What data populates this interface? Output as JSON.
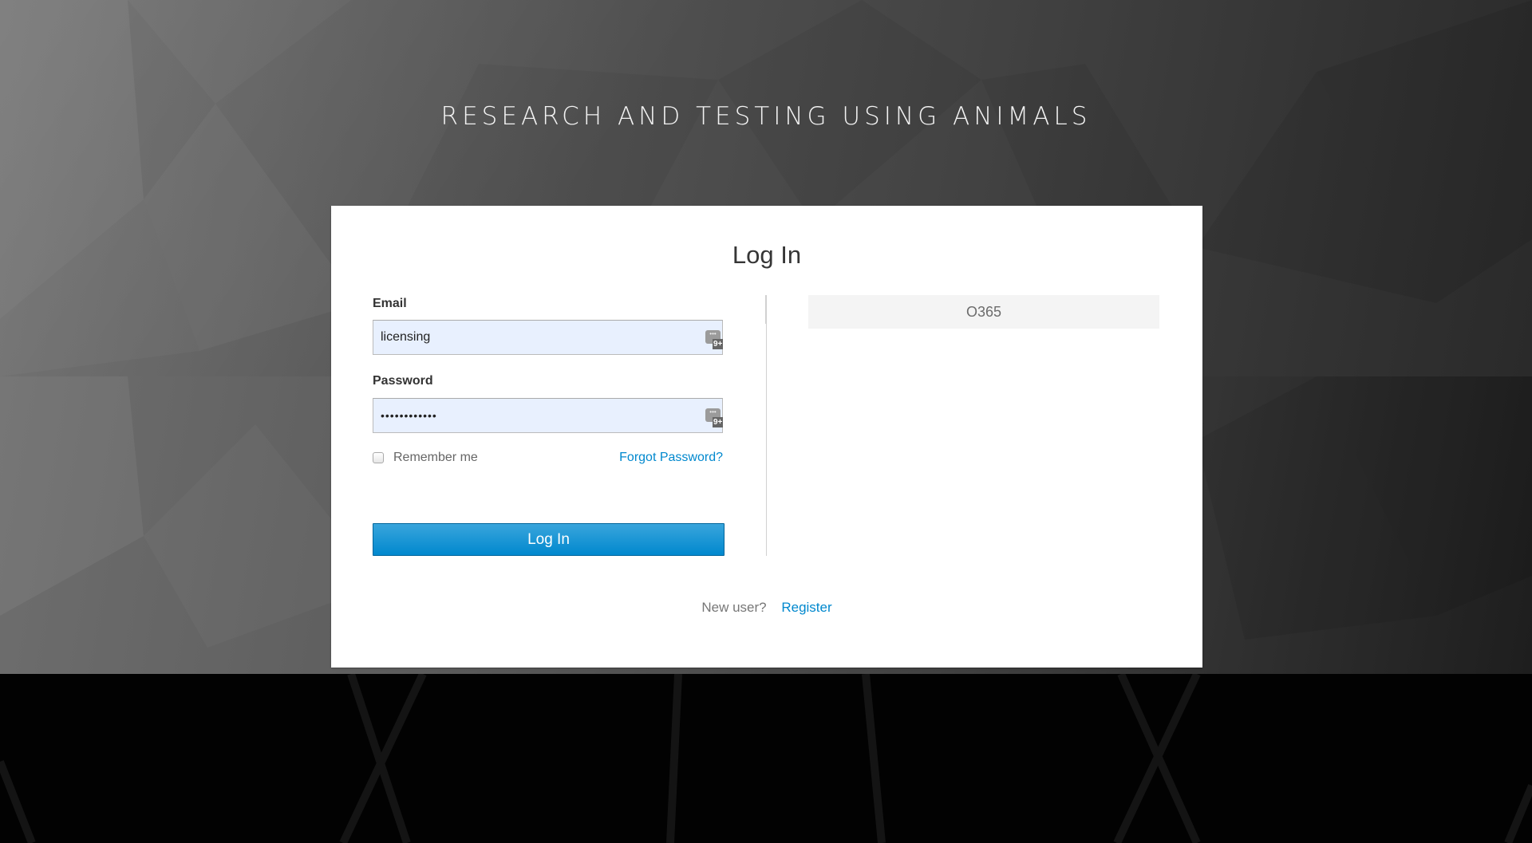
{
  "site": {
    "title": "RESEARCH AND TESTING USING ANIMALS"
  },
  "login": {
    "heading": "Log In",
    "email": {
      "label": "Email",
      "value": "licensing"
    },
    "password": {
      "label": "Password",
      "value_masked": "••••••••••••"
    },
    "password_manager_icon": {
      "glyph": "•••",
      "badge": "9+"
    },
    "remember_me": {
      "label": "Remember me",
      "checked": false
    },
    "forgot_password_label": "Forgot Password?",
    "submit_label": "Log In",
    "identity_providers": [
      {
        "label": "O365"
      }
    ],
    "register": {
      "prompt": "New user?",
      "link_label": "Register"
    }
  },
  "colors": {
    "accent": "#0088ce",
    "button_gradient_top": "#39a5dc",
    "input_autofill_bg": "#e8f0fe",
    "provider_button_bg": "#f4f4f4"
  }
}
